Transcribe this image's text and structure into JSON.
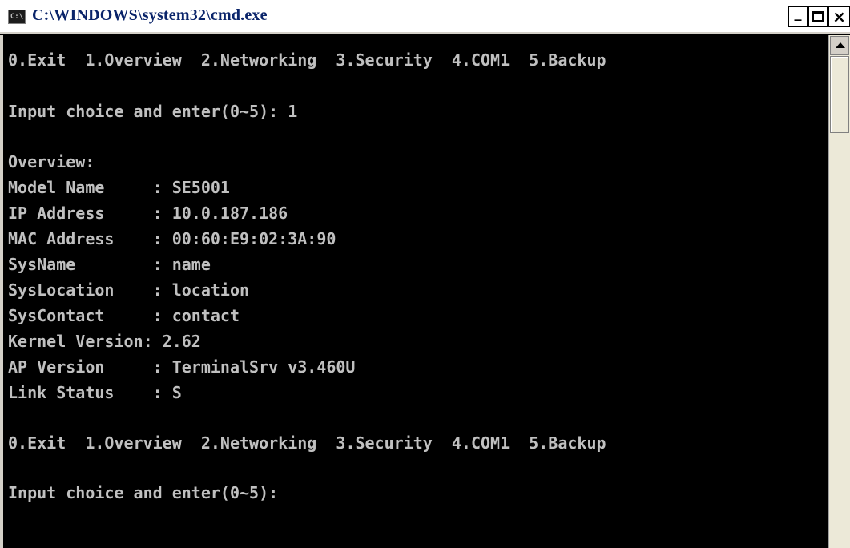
{
  "window": {
    "title": "C:\\WINDOWS\\system32\\cmd.exe",
    "icon_text": "C:\\",
    "minimize_glyph": "_",
    "close_glyph": "×"
  },
  "console": {
    "lines": [
      "",
      "0.Exit  1.Overview  2.Networking  3.Security  4.COM1  5.Backup",
      "",
      "Input choice and enter(0~5): 1",
      "",
      "Overview:",
      "Model Name     : SE5001",
      "IP Address     : 10.0.187.186",
      "MAC Address    : 00:60:E9:02:3A:90",
      "SysName        : name",
      "SysLocation    : location",
      "SysContact     : contact",
      "Kernel Version: 2.62",
      "AP Version     : TerminalSrv v3.460U",
      "Link Status    : S",
      "",
      "0.Exit  1.Overview  2.Networking  3.Security  4.COM1  5.Backup",
      "",
      "Input choice and enter(0~5):"
    ]
  },
  "colors": {
    "console_bg": "#000000",
    "console_fg": "#c0c0c0",
    "title_text": "#0a246a"
  },
  "icons": [
    "cmd-app-icon",
    "minimize-icon",
    "maximize-icon",
    "close-icon",
    "scroll-up-arrow-icon"
  ]
}
